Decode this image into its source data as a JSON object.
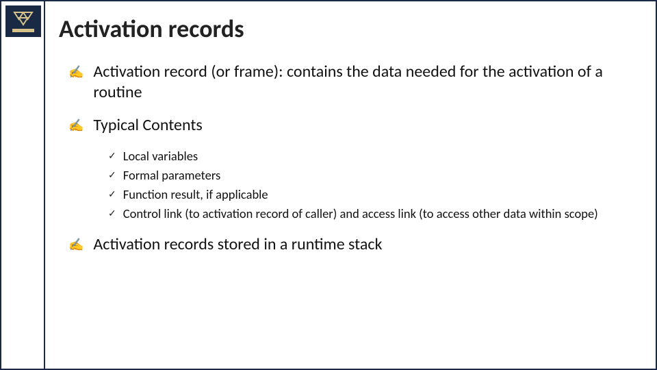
{
  "slide": {
    "title": "Activation records",
    "bullets": [
      {
        "text": "Activation record (or frame):  contains the data needed for the activation of a routine",
        "sub": []
      },
      {
        "text": "Typical Contents",
        "sub": [
          "Local variables",
          "Formal parameters",
          "Function result, if applicable",
          "Control link (to activation record of caller) and access link (to access other data within scope)"
        ]
      },
      {
        "text": "Activation records stored in a runtime stack",
        "sub": []
      }
    ]
  },
  "markers": {
    "level1": "✍",
    "level2": "✓"
  }
}
